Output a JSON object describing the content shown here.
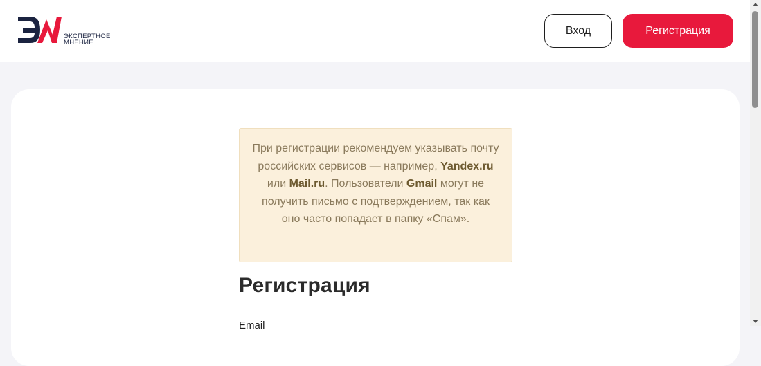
{
  "header": {
    "logo": {
      "line1": "ЭКСПЕРТНОЕ",
      "line2": "МНЕНИЕ"
    },
    "login_label": "Вход",
    "register_label": "Регистрация"
  },
  "notice": {
    "t1": "При регистрации рекомендуем указывать почту российских сервисов — например, ",
    "b1": "Yandex.ru",
    "t2": " или ",
    "b2": "Mail.ru",
    "t3": ". Пользователи ",
    "b3": "Gmail",
    "t4": " могут не получить письмо с подтверждением, так как оно часто попадает в папку «Спам»."
  },
  "form": {
    "title": "Регистрация",
    "email_label": "Email"
  },
  "colors": {
    "accent": "#e8193c",
    "brand_navy": "#1b2340",
    "notice_bg": "#fbf0dc",
    "page_bg": "#f4f4f8"
  }
}
